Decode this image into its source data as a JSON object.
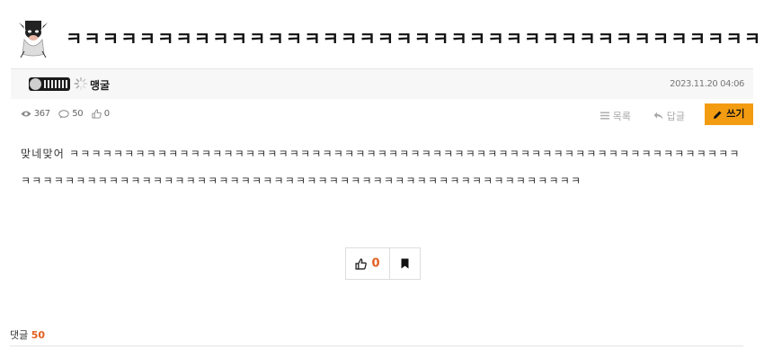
{
  "post": {
    "title": "ㅋㅋㅋㅋㅋㅋㅋㅋㅋㅋㅋㅋㅋㅋㅋㅋㅋㅋㅋㅋㅋㅋㅋㅋㅋㅋㅋㅋㅋㅋㅋㅋㅋㅋㅋㅋㅋㅋ",
    "author": "맹굴",
    "date": "2023.11.20 04:06",
    "views": "367",
    "comments": "50",
    "likes": "0",
    "body": "맞네맞어 ㅋㅋㅋㅋㅋㅋㅋㅋㅋㅋㅋㅋㅋㅋㅋㅋㅋㅋㅋㅋㅋㅋㅋㅋㅋㅋㅋㅋㅋㅋㅋㅋㅋㅋㅋㅋㅋㅋㅋㅋㅋㅋㅋㅋㅋㅋㅋㅋㅋㅋㅋㅋㅋㅋㅋㅋㅋㅋㅋㅋㅋㅋㅋㅋㅋㅋㅋㅋㅋㅋㅋㅋㅋㅋㅋㅋㅋㅋㅋㅋㅋㅋㅋㅋㅋㅋㅋㅋㅋㅋㅋㅋㅋㅋㅋㅋㅋㅋㅋㅋㅋㅋㅋㅋㅋㅋㅋㅋㅋㅋㅋㅋ"
  },
  "actions": {
    "list_label": "목록",
    "reply_label": "답글",
    "write_label": "쓰기"
  },
  "vote": {
    "like_count": "0"
  },
  "comments_section": {
    "label": "댓글",
    "count": "50"
  },
  "icons": {
    "views": "eye-icon",
    "comments": "comment-icon",
    "likes": "thumbs-up-icon",
    "list": "list-icon",
    "reply": "reply-icon",
    "write": "pencil-icon",
    "bookmark": "bookmark-icon"
  },
  "colors": {
    "accent": "#f39c12",
    "count_highlight": "#e25f1f"
  }
}
